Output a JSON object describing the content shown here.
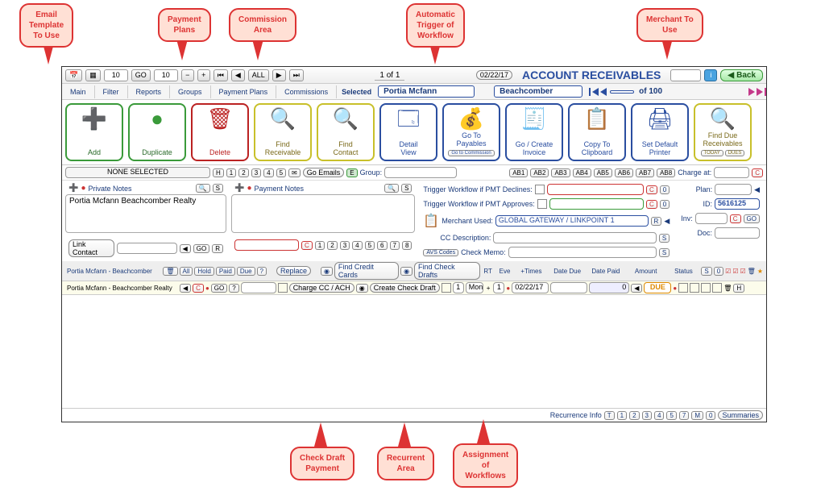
{
  "callouts": {
    "email_template": "Email\nTemplate\nTo Use",
    "payment_plans": "Payment\nPlans",
    "commission_area": "Commission\nArea",
    "auto_trigger": "Automatic\nTrigger of\nWorkflow",
    "merchant_use": "Merchant To\nUse",
    "check_draft": "Check Draft\nPayment",
    "recurrent_area": "Recurrent\nArea",
    "assign_workflows": "Assignment\nof\nWorkflows"
  },
  "toolbar": {
    "page_input1": "10",
    "go": "GO",
    "page_input2": "10",
    "all": "ALL",
    "pager": "1 of 1",
    "date": "02/22/17",
    "back": "Back"
  },
  "title": "ACCOUNT RECEIVABLES",
  "tabs": {
    "main": "Main",
    "filter": "Filter",
    "reports": "Reports",
    "groups": "Groups",
    "payment_plans": "Payment Plans",
    "commissions": "Commissions",
    "selected_label": "Selected",
    "selected_value": "Portia Mcfann",
    "company": "Beachcomber",
    "of_label": "of 100"
  },
  "iconbar": {
    "add": "Add",
    "duplicate": "Duplicate",
    "delete": "Delete",
    "find_receivable": "Find\nReceivable",
    "find_contact": "Find\nContact",
    "detail_view": "Detail\nView",
    "go_payables": "Go To\nPayables",
    "go_commission": "Go to Commission",
    "go_invoice": "Go / Create\nInvoice",
    "copy_clipboard": "Copy To\nClipboard",
    "set_printer": "Set Default\nPrinter",
    "find_due": "Find Due\nReceivables",
    "today": "TODAY",
    "dues": "DUES"
  },
  "midbar": {
    "none_selected": "NONE SELECTED",
    "go_emails": "Go Emails",
    "group_label": "Group:",
    "ab_buttons": [
      "AB1",
      "AB2",
      "AB3",
      "AB4",
      "AB5",
      "AB6",
      "AB7",
      "AB8"
    ],
    "charge_at": "Charge at:"
  },
  "notes": {
    "private_label": "Private Notes",
    "payment_label": "Payment Notes",
    "private_text": "Portia Mcfann Beachcomber Realty",
    "link_contact": "Link Contact",
    "go": "GO",
    "pager_nums": [
      "1",
      "2",
      "3",
      "4",
      "5",
      "6",
      "7",
      "8"
    ]
  },
  "workflow": {
    "decline_label": "Trigger Workflow if PMT Declines:",
    "approve_label": "Trigger Workflow if PMT Approves:",
    "merchant_label": "Merchant Used:",
    "merchant_value": "GLOBAL GATEWAY / LINKPOINT 1",
    "cc_desc": "CC Description:",
    "check_memo": "Check Memo:",
    "avs": "AVS Codes"
  },
  "side": {
    "plan": "Plan:",
    "id_label": "ID:",
    "id_value": "5616125",
    "inv": "Inv:",
    "doc": "Doc:",
    "go": "GO"
  },
  "grid": {
    "header_person": "Portia Mcfann - Beachcomber",
    "btn_all": "All",
    "btn_hold": "Hold",
    "btn_paid": "Paid",
    "btn_due": "Due",
    "replace": "Replace",
    "find_cc": "Find Credit Cards",
    "find_check": "Find Check Drafts",
    "col_rt": "RT",
    "col_eve": "Eve",
    "col_times": "+Times",
    "col_datedue": "Date Due",
    "col_datepaid": "Date Paid",
    "col_amount": "Amount",
    "col_status": "Status",
    "row_person": "Portia Mcfann - Beachcomber Realty",
    "go": "GO",
    "charge": "Charge CC / ACH",
    "create_draft": "Create Check Draft",
    "times_val": "1",
    "unit": "Mon",
    "plus": "+",
    "plus_val": "1",
    "date": "02/22/17",
    "amount": "0",
    "status": "DUE"
  },
  "footer": {
    "recurrence": "Recurrence Info",
    "labels": [
      "T",
      "1",
      "2",
      "3",
      "4",
      "5",
      "7",
      "M",
      "0"
    ],
    "summaries": "Summaries"
  }
}
